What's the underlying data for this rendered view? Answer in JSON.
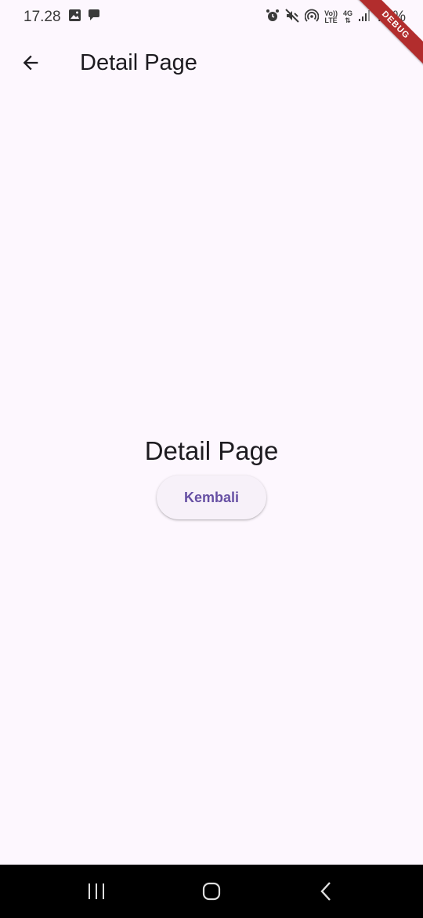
{
  "status_bar": {
    "time": "17.28",
    "left_icons": [
      "image-icon",
      "chat-bubble-icon"
    ],
    "right_icons": [
      "alarm-icon",
      "mute-icon",
      "hotspot-icon",
      "volte-icon",
      "4g-icon",
      "signal-icon"
    ],
    "volte_top": "Vo))",
    "volte_bottom": "LTE",
    "network": "4G",
    "battery": "77%"
  },
  "debug_banner": {
    "label": "DEBUG"
  },
  "app_bar": {
    "title": "Detail Page",
    "back_icon": "arrow-back-icon"
  },
  "body": {
    "title": "Detail Page",
    "button_label": "Kembali"
  },
  "nav_bar": {
    "icons": [
      "recent-apps-icon",
      "home-icon",
      "back-icon"
    ]
  },
  "colors": {
    "background": "#fdf7fe",
    "primary": "#6750a4",
    "button_bg": "#f7f1f9",
    "debug": "#b22d2d"
  }
}
